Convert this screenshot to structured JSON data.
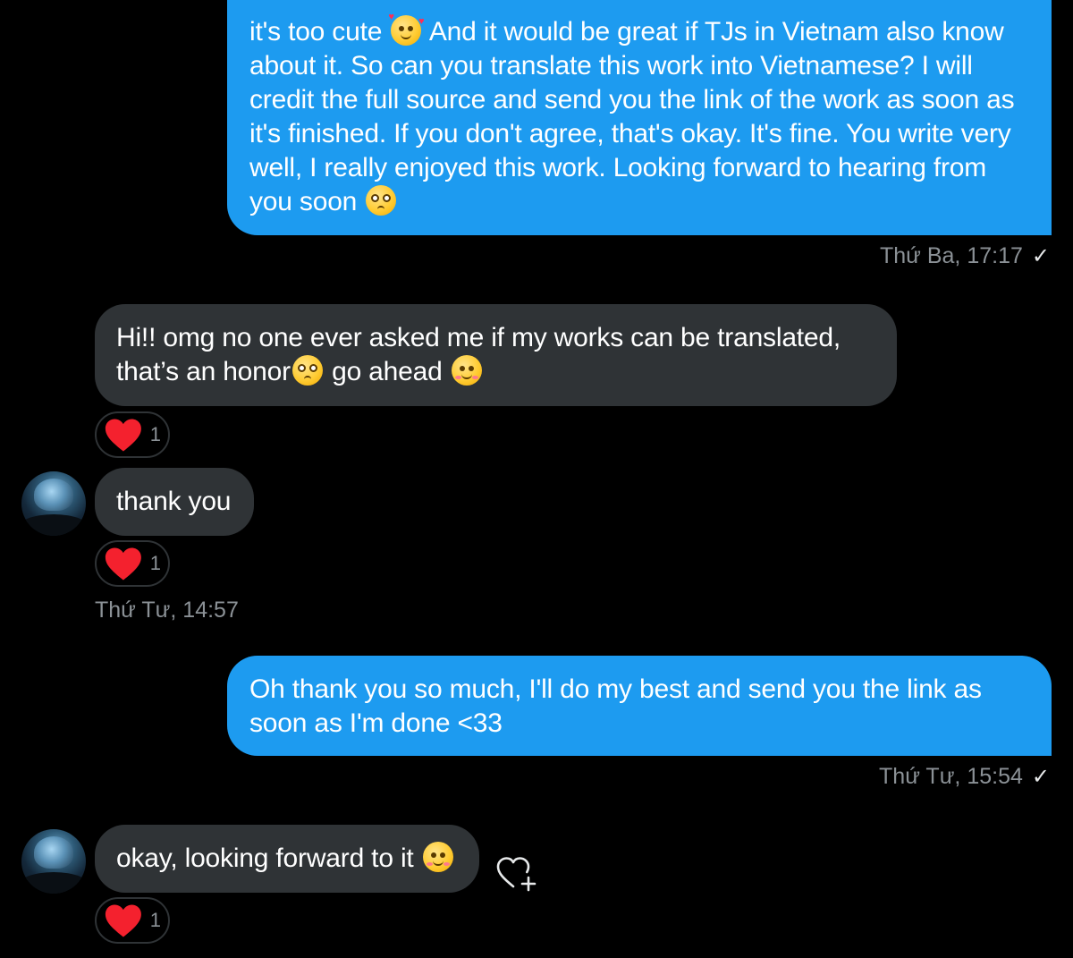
{
  "conversation": {
    "msg1": {
      "line1_a": "it's too cute",
      "line1_b": "And it would be great if TJs in Vietnam also know",
      "line2": "about it. So can you translate this work into Vietnamese? I will",
      "line3": "credit the full source and send you the link of the work as soon as",
      "line4": "it's finished. If you don't agree, that's okay. It's fine. You write very",
      "line5": "well, I really enjoyed this work. Looking forward to hearing from",
      "line6": "you soon",
      "timestamp": "Thứ Ba, 17:17"
    },
    "msg2": {
      "line1": "Hi!! omg no one ever asked me if my works can be translated,",
      "line2_a": "that’s an honor",
      "line2_b": "go ahead",
      "reaction_count": "1"
    },
    "msg3": {
      "text": "thank you",
      "reaction_count": "1",
      "timestamp": "Thứ Tư, 14:57"
    },
    "msg4": {
      "line1": "Oh thank you so much, I'll do my best and send you the link as",
      "line2": "soon as I'm done <33",
      "timestamp": "Thứ Tư, 15:54"
    },
    "msg5": {
      "text": "okay, looking forward to it",
      "reaction_count": "1"
    }
  },
  "icons": {
    "read_receipt": "checkmark-icon",
    "reaction": "red-heart-icon",
    "add_reaction": "heart-plus-icon",
    "emoji_hearts": "smiling-face-with-hearts",
    "emoji_pleading": "pleading-face",
    "emoji_blush": "smiling-face-with-smiling-eyes"
  },
  "colors": {
    "background": "#000000",
    "outgoing_bubble": "#1d9bf0",
    "incoming_bubble": "#2f3336",
    "timestamp_text": "#8b9196",
    "reaction_heart": "#f4212e"
  }
}
